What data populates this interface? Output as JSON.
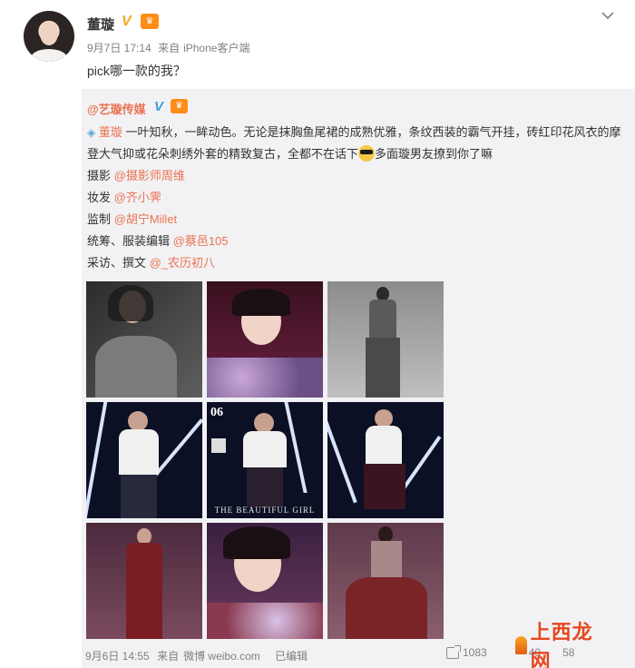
{
  "author": {
    "name": "董璇",
    "date": "9月7日 17:14",
    "source_prefix": "来自",
    "source": "iPhone客户端",
    "text": "pick哪一款的我？"
  },
  "icons": {
    "verified": "verified-v-icon",
    "vip": "vip-badge-icon",
    "chevron": "chevron-down-icon"
  },
  "repost": {
    "author": "@艺璇传媒",
    "line1_mention": "董璇",
    "line1_text": " 一叶知秋，一眸动色。无论是抹胸鱼尾裙的成熟优雅，条纹西装的霸气开挂，砖红印花风衣的摩登大气抑或花朵刺绣外套的精致复古，全都不在话下",
    "line1_end": "多面璇男友撩到你了嘛",
    "credits": [
      {
        "label": "摄影 ",
        "handle": "@摄影师周维"
      },
      {
        "label": "妆发 ",
        "handle": "@齐小霁"
      },
      {
        "label": "监制 ",
        "handle": "@胡宁Millet"
      },
      {
        "label": "统筹、服装编辑 ",
        "handle": "@蔡邑105"
      },
      {
        "label": "采访、撰文 ",
        "handle": "@_农历初八"
      }
    ],
    "cover_number": "06",
    "cover_title": "THE BEAUTIFUL GIRL",
    "date": "9月6日 14:55",
    "source_prefix": "来自",
    "source": "微博 weibo.com",
    "edited": "已编辑",
    "repost_count": "1083",
    "comment_count": "40",
    "like_count": "58"
  },
  "watermark": "上西龙网",
  "colors": {
    "link": "#eb7350",
    "repost_bg": "#f2f2f5"
  }
}
